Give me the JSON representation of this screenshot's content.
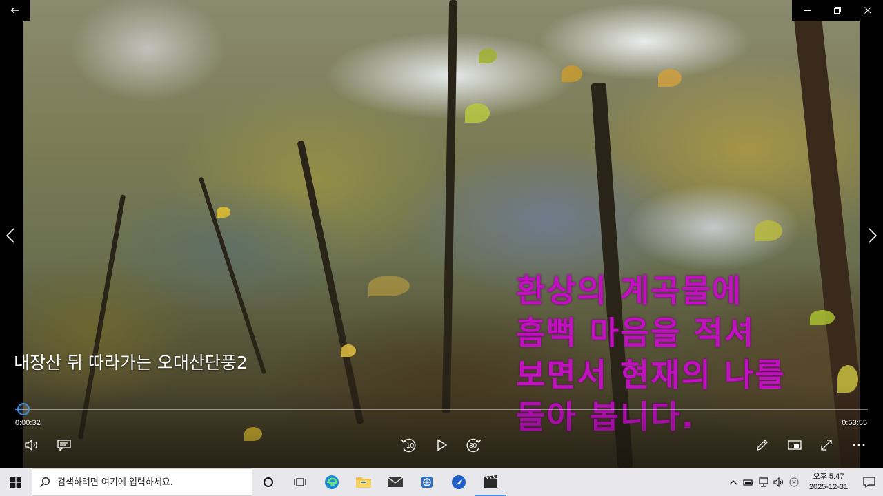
{
  "window": {
    "back_icon": "back-arrow-icon",
    "minimize_icon": "minimize-icon",
    "restore_icon": "restore-icon",
    "close_icon": "close-icon"
  },
  "video": {
    "title": "내장산 뒤 따라가는 오대산단풍2",
    "overlay_lines": "환상의 계곡물에\n흠뻑 마음을 적셔\n보면서 현재의 나를\n돌아 봅니다.",
    "overlay_color": "#c010c0"
  },
  "player": {
    "current_time": "0:00:32",
    "total_time": "0:53:55",
    "progress_fraction": 0.0099,
    "accent_color": "#3c8fe0",
    "skip_back_label": "10",
    "skip_forward_label": "30"
  },
  "taskbar": {
    "search_placeholder": "검색하려면 여기에 입력하세요.",
    "clock_time": "오후 5:47",
    "clock_date": "2025-12-31"
  }
}
